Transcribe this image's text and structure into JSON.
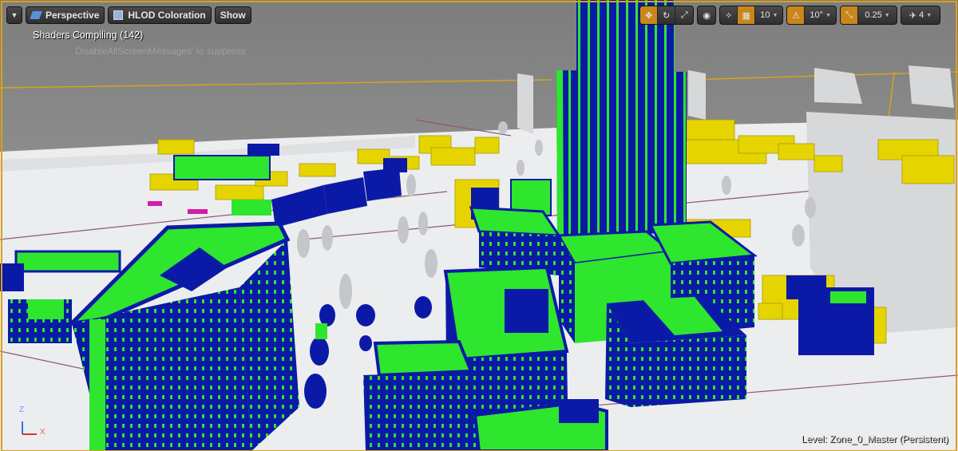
{
  "toolbar_left": {
    "menu_icon": "chevron-down-icon",
    "view_mode": "Perspective",
    "visualizer": "HLOD Coloration",
    "show_label": "Show"
  },
  "toolbar_right": {
    "grid_snap_value": "10",
    "rotation_snap_value": "10°",
    "scale_snap_value": "0.25",
    "camera_speed_value": "4",
    "icons": [
      "select-move-icon",
      "rotate-icon",
      "scale-icon",
      "world-local-icon",
      "surface-snap-icon",
      "grid-snap-icon",
      "rotation-snap-icon",
      "scale-snap-icon",
      "camera-speed-icon"
    ]
  },
  "messages": {
    "shader_status": "Shaders Compiling (142)",
    "suppress_hint": "DisableAllScreenMessages' to suppress"
  },
  "status": {
    "level_label": "Level:",
    "level_name": "Zone_0_Master (Persistent)"
  },
  "axis": {
    "z": "Z",
    "x": "X"
  },
  "colors": {
    "accent": "#d9a21a",
    "active_button": "#c8861c",
    "hlod_blue": "#0b1aa6",
    "hlod_green": "#2ee62e",
    "hlod_yellow": "#e6d400",
    "sky": "#858585",
    "ground": "#ecedee"
  }
}
